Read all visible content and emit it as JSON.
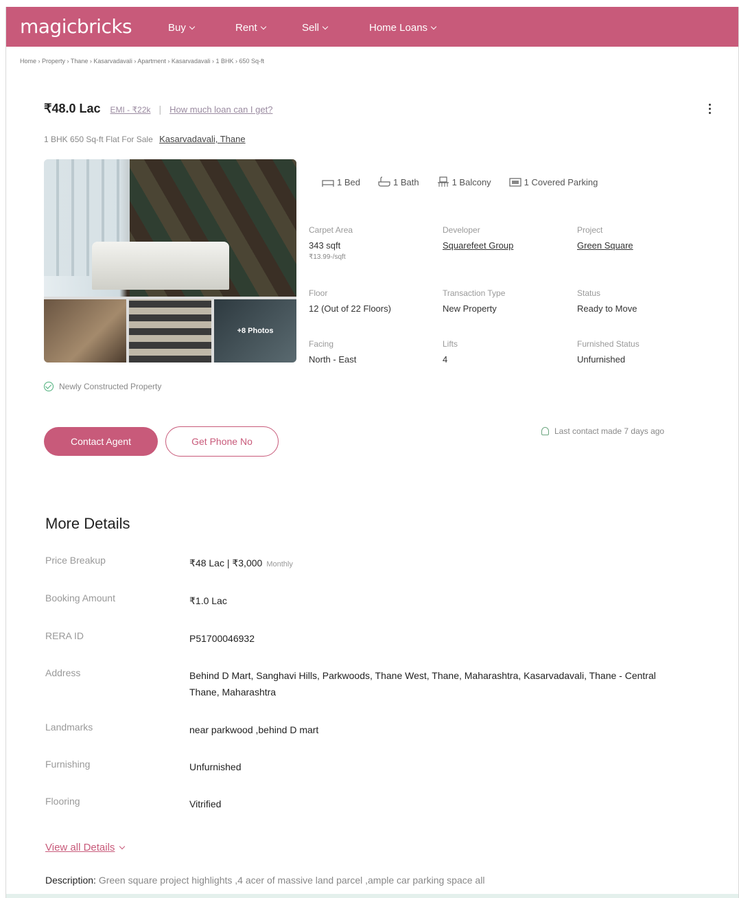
{
  "header": {
    "logo": "magicbricks",
    "nav": [
      {
        "label": "Buy"
      },
      {
        "label": "Rent"
      },
      {
        "label": "Sell"
      },
      {
        "label": "Home Loans"
      }
    ]
  },
  "breadcrumb": "Home › Property › Thane › Kasarvadavali › Apartment › Kasarvadavali › 1 BHK › 650 Sq-ft",
  "listing": {
    "price": "₹48.0 Lac",
    "emi": "EMI - ₹22k",
    "loan_link": "How much loan can I get?",
    "subtitle": "1 BHK 650 Sq-ft Flat For Sale",
    "location_link": "Kasarvadavali, Thane",
    "photos_label": "+8 Photos",
    "amenities": {
      "bed": "1 Bed",
      "bath": "1 Bath",
      "balcony": "1 Balcony",
      "parking": "1 Covered Parking"
    },
    "specs": {
      "carpet_area_label": "Carpet Area",
      "carpet_area_value": "343 sqft",
      "carpet_area_rate": "₹13.99-/sqft",
      "developer_label": "Developer",
      "developer_value": "Squarefeet Group",
      "project_label": "Project",
      "project_value": "Green Square",
      "floor_label": "Floor",
      "floor_value": "12 (Out of 22 Floors)",
      "transaction_label": "Transaction Type",
      "transaction_value": "New Property",
      "status_label": "Status",
      "status_value": "Ready to Move",
      "facing_label": "Facing",
      "facing_value": "North - East",
      "lifts_label": "Lifts",
      "lifts_value": "4",
      "furnished_label": "Furnished Status",
      "furnished_value": "Unfurnished"
    },
    "newly_constructed": "Newly Constructed Property",
    "contact_button": "Contact Agent",
    "phone_button": "Get Phone No",
    "last_contact": "Last contact made 7 days ago"
  },
  "more_details": {
    "title": "More Details",
    "rows": [
      {
        "key": "Price Breakup",
        "value": "₹48 Lac | ₹3,000",
        "extra": "Monthly"
      },
      {
        "key": "Booking Amount",
        "value": "₹1.0 Lac"
      },
      {
        "key": "RERA ID",
        "value": "P51700046932"
      },
      {
        "key": "Address",
        "value": "Behind D Mart, Sanghavi Hills, Parkwoods, Thane West, Thane, Maharashtra, Kasarvadavali, Thane - Central Thane, Maharashtra"
      },
      {
        "key": "Landmarks",
        "value": "near parkwood ,behind D mart"
      },
      {
        "key": "Furnishing",
        "value": "Unfurnished"
      },
      {
        "key": "Flooring",
        "value": "Vitrified"
      }
    ],
    "view_all": "View all Details",
    "description_label": "Description:",
    "description_text": "Green square project highlights ,4 acer of massive land parcel ,ample car parking space all"
  }
}
